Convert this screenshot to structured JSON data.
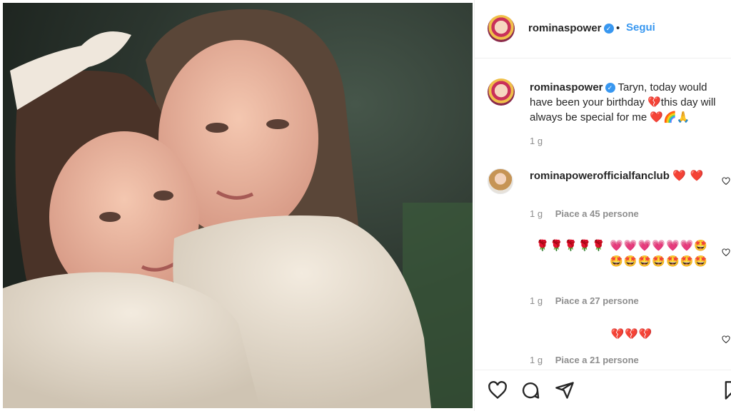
{
  "post": {
    "username": "rominaspower",
    "follow_label": "Segui",
    "separator": "•",
    "caption": "Taryn, today would have been your birthday 💔this day will always be special for me ❤️🌈🙏",
    "time": "1 g"
  },
  "comments": [
    {
      "username": "rominapowerofficialfanclub",
      "text": "❤️ ❤️",
      "time": "1 g",
      "likes": "Piace a 45 persone"
    },
    {
      "username": "",
      "text": "🌹🌹🌹🌹🌹 💗💗💗💗💗💗🤩🤩🤩🤩🤩🤩🤩🤩",
      "time": "1 g",
      "likes": "Piace a 27 persone"
    },
    {
      "username": "",
      "text": "💔💔💔",
      "time": "1 g",
      "likes": "Piace a 21 persone"
    }
  ],
  "icons": {
    "like": "heart-icon",
    "comment": "comment-icon",
    "share": "share-icon",
    "save": "bookmark-icon",
    "verified": "verified-badge-icon"
  },
  "colors": {
    "link_blue": "#3897f0",
    "text": "#262626",
    "muted": "#8e8e8e",
    "border": "#efefef"
  }
}
